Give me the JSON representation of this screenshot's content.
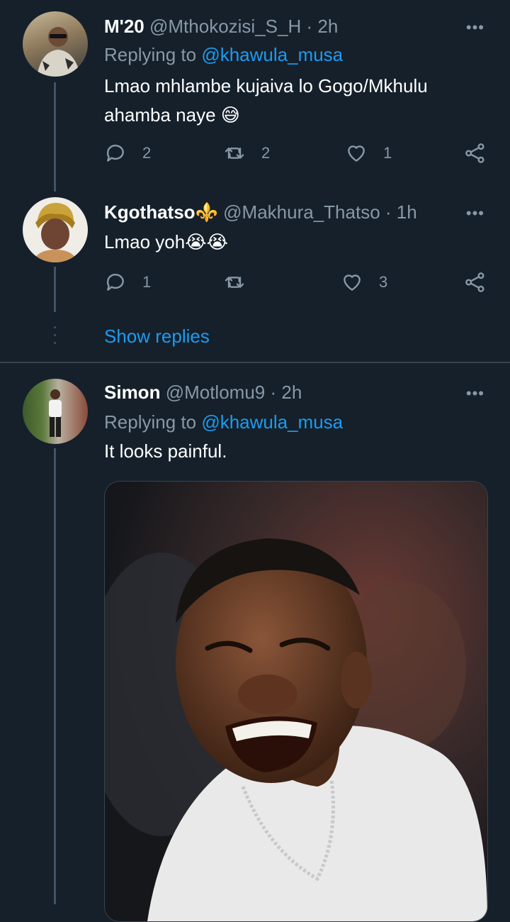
{
  "tweets": [
    {
      "name": "M'20",
      "handle": "@Mthokozisi_S_H",
      "time": "· 2h",
      "replying_prefix": "Replying to ",
      "replying_to": "@khawula_musa",
      "text_line1": "Lmao mhlambe kujaiva lo Gogo/Mkhulu",
      "text_line2": "ahamba naye",
      "emoji": "😅",
      "replies": "2",
      "retweets": "2",
      "likes": "1"
    },
    {
      "name": "Kgothatso",
      "name_emoji": "⚜️",
      "handle": "@Makhura_Thatso",
      "time": "· 1h",
      "text": "Lmao yoh",
      "emoji": "😭😭",
      "replies": "1",
      "retweets": "",
      "likes": "3"
    },
    {
      "name": "Simon",
      "handle": "@Motlomu9",
      "time": "· 2h",
      "replying_prefix": "Replying to ",
      "replying_to": "@khawula_musa",
      "text": "It looks painful."
    }
  ],
  "show_replies": "Show replies",
  "more_glyph": "•••",
  "colors": {
    "background": "#15202b",
    "accent": "#1d9bf0",
    "muted": "#8899a6",
    "divider": "#38444d"
  }
}
